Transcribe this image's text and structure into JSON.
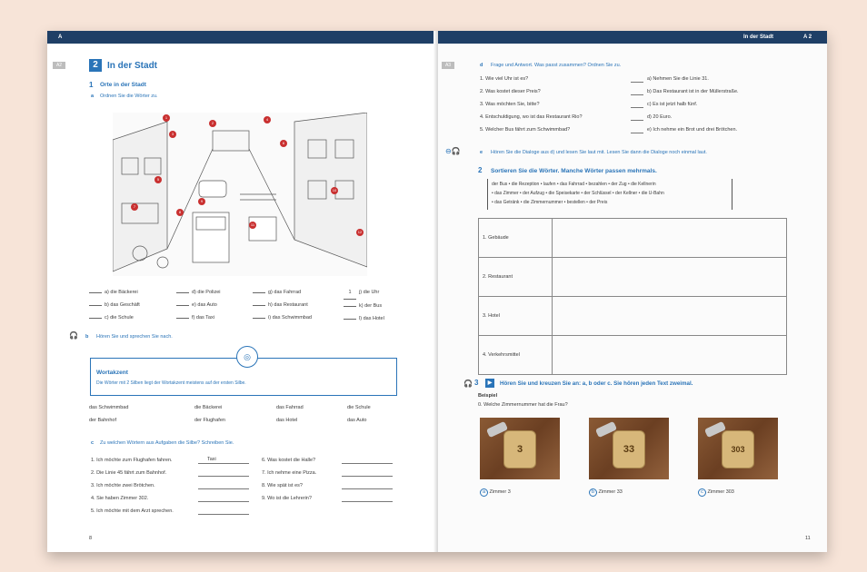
{
  "left": {
    "header": {
      "page_letter": "A"
    },
    "side_tag": "A2",
    "chapter": {
      "number": "2",
      "title": "In der Stadt"
    },
    "section1": {
      "number": "1",
      "title": "Orte in der Stadt"
    },
    "task_a": {
      "letter": "a",
      "text": "Ordnen Sie die Wörter zu."
    },
    "match_cols": [
      [
        "a) die Bäckerei",
        "b) das Geschäft",
        "c) die Schule"
      ],
      [
        "d) die Polizei",
        "e) das Auto",
        "f) das Taxi"
      ],
      [
        "g) das Fahrrad",
        "h) das Restaurant",
        "i) das Schwimmbad"
      ],
      [
        "j) die Uhr",
        "k) der Bus",
        "l) das Hotel"
      ]
    ],
    "example_answer": "1",
    "task_b": {
      "letter": "b",
      "text": "Hören Sie und sprechen Sie nach."
    },
    "wortakzent": {
      "title": "Wortakzent",
      "text": "Die Wörter mit 2 Silben liegt der Wortakzent meistens auf der ersten Silbe."
    },
    "word_rows": [
      [
        "das Schwimmbad",
        "die Bäckerei",
        "das Fahrrad",
        "die Schule"
      ],
      [
        "der Bahnhof",
        "der Flughafen",
        "das Hotel",
        "das Auto"
      ]
    ],
    "task_c": {
      "letter": "c",
      "text": "Zu welchen Wörtern aus Aufgaben die Silbe? Schreiben Sie."
    },
    "sentences_left": [
      "1. Ich möchte zum Flughafen fahren.",
      "2. Die Linie 45 fährt zum Bahnhof.",
      "3. Ich möchte zwei Brötchen.",
      "4. Sie haben Zimmer 302.",
      "5. Ich möchte mit dem Arzt sprechen."
    ],
    "sentence_example": "Taxi",
    "sentences_right": [
      "6. Was kostet die Halle?",
      "7. Ich nehme eine Pizza.",
      "8. Wie spät ist es?",
      "9. Wo ist die Lehrerin?"
    ],
    "page_number": "8"
  },
  "right": {
    "header": {
      "title": "In der Stadt",
      "code": "A 2"
    },
    "side_tag": "A3",
    "task_d": {
      "letter": "d",
      "text": "Frage und Antwort. Was passt zusammen? Ordnen Sie zu."
    },
    "questions": [
      "1. Wie viel Uhr ist es?",
      "2. Was kostet dieser Preis?",
      "3. Was möchten Sie, bitte?",
      "4. Entschuldigung, wo ist das Restaurant Rio?",
      "5. Welcher Bus fährt zum Schwimmbad?"
    ],
    "answers": [
      "a) Nehmen Sie die Linie 31.",
      "b) Das Restaurant ist in der Müllerstraße.",
      "c) Es ist jetzt halb fünf.",
      "d) 20 Euro.",
      "e) Ich nehme ein Brot und drei Brötchen."
    ],
    "task_e": {
      "letter": "e",
      "text": "Hören Sie die Dialoge aus d) und lesen Sie laut mit. Lesen Sie dann die Dialoge noch einmal laut."
    },
    "section2": {
      "number": "2",
      "title": "Sortieren Sie die Wörter. Manche Wörter passen mehrmals."
    },
    "wordbox": [
      "der Bus • die Rezeption • laufen • das Fahrrad • bezahlen • der Zug • die Kellnerin",
      "• das Zimmer • der Aufzug • die Speisekarte • der Schlüssel • der Kellner • die U-Bahn",
      "• das Getränk • die Zimmernummer • bestellen • der Preis"
    ],
    "table_rows": [
      "1. Gebäude",
      "2. Restaurant",
      "3. Hotel",
      "4. Verkehrsmittel"
    ],
    "section3": {
      "number": "3",
      "title": "Hören Sie und kreuzen Sie an: a, b oder c. Sie hören jeden Text zweimal."
    },
    "example": {
      "label": "Beispiel",
      "question": "0. Welche Zimmernummer hat die Frau?"
    },
    "options": [
      {
        "letter": "a",
        "tag": "3",
        "label": "Zimmer 3"
      },
      {
        "letter": "b",
        "tag": "33",
        "label": "Zimmer 33"
      },
      {
        "letter": "c",
        "tag": "303",
        "label": "Zimmer 303"
      }
    ],
    "page_number": "11"
  },
  "colors": {
    "accent": "#2a74b8",
    "header_bar": "#1f3f66",
    "background": "#f7e4d8"
  }
}
